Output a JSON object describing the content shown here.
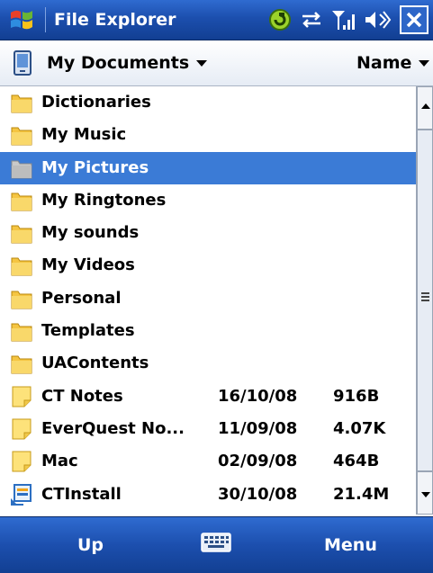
{
  "window": {
    "title": "File Explorer",
    "icons": [
      "windows-start-icon",
      "connectivity-icon",
      "sync-icon",
      "signal-icon",
      "volume-icon",
      "close-icon"
    ]
  },
  "header": {
    "location": "My Documents",
    "sort_label": "Name"
  },
  "list": {
    "items": [
      {
        "name": "Dictionaries",
        "type": "folder",
        "date": "",
        "size": "",
        "selected": false
      },
      {
        "name": "My Music",
        "type": "folder",
        "date": "",
        "size": "",
        "selected": false
      },
      {
        "name": "My Pictures",
        "type": "folder",
        "date": "",
        "size": "",
        "selected": true
      },
      {
        "name": "My Ringtones",
        "type": "folder",
        "date": "",
        "size": "",
        "selected": false
      },
      {
        "name": "My sounds",
        "type": "folder",
        "date": "",
        "size": "",
        "selected": false
      },
      {
        "name": "My Videos",
        "type": "folder",
        "date": "",
        "size": "",
        "selected": false
      },
      {
        "name": "Personal",
        "type": "folder",
        "date": "",
        "size": "",
        "selected": false
      },
      {
        "name": "Templates",
        "type": "folder",
        "date": "",
        "size": "",
        "selected": false
      },
      {
        "name": "UAContents",
        "type": "folder",
        "date": "",
        "size": "",
        "selected": false
      },
      {
        "name": "CT Notes",
        "type": "note",
        "date": "16/10/08",
        "size": "916B",
        "selected": false
      },
      {
        "name": "EverQuest No...",
        "type": "note",
        "date": "11/09/08",
        "size": "4.07K",
        "selected": false
      },
      {
        "name": "Mac",
        "type": "note",
        "date": "02/09/08",
        "size": "464B",
        "selected": false
      },
      {
        "name": "CTInstall",
        "type": "installer",
        "date": "30/10/08",
        "size": "21.4M",
        "selected": false
      }
    ]
  },
  "softkeys": {
    "left": "Up",
    "right": "Menu"
  },
  "colors": {
    "titlebar": "#1c4fae",
    "selection": "#3b7bd6",
    "folder": "#f5c542"
  }
}
